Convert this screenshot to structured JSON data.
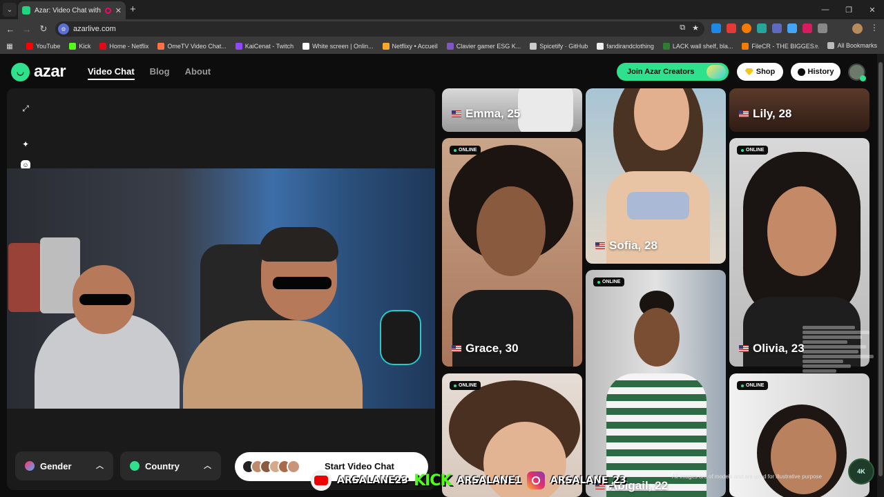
{
  "browser": {
    "tab_title": "Azar: Video Chat with New",
    "url": "azarlive.com",
    "bookmarks": [
      {
        "label": "YouTube",
        "color": "#ff0000"
      },
      {
        "label": "Kick",
        "color": "#53fc18"
      },
      {
        "label": "Home - Netflix",
        "color": "#e50914"
      },
      {
        "label": "OmeTV Video Chat...",
        "color": "#ff7043"
      },
      {
        "label": "KaiCenat - Twitch",
        "color": "#9146ff"
      },
      {
        "label": "White screen | Onlin...",
        "color": "#ffffff"
      },
      {
        "label": "Netflixy • Accueil",
        "color": "#f9a825"
      },
      {
        "label": "Clavier gamer ESG K...",
        "color": "#7e57c2"
      },
      {
        "label": "Spicetify · GitHub",
        "color": "#cccccc"
      },
      {
        "label": "fandirandclothing",
        "color": "#eeeeee"
      },
      {
        "label": "LACK wall shelf, bla...",
        "color": "#2e7d32"
      },
      {
        "label": "FileCR - THE BIGGES...",
        "color": "#f57c00"
      }
    ],
    "all_bookmarks": "All Bookmarks"
  },
  "site": {
    "logo": "azar",
    "nav": [
      "Video Chat",
      "Blog",
      "About"
    ],
    "creators_button": "Join Azar Creators",
    "shop_button": "Shop",
    "history_button": "History"
  },
  "controls": {
    "gender": "Gender",
    "country": "Country",
    "start": "Start Video Chat"
  },
  "gallery": {
    "online_label": "ONLINE",
    "profiles": [
      {
        "name": "Emma, 25",
        "online": false
      },
      {
        "name": "Sofia, 28",
        "online": false
      },
      {
        "name": "Lily, 28",
        "online": false
      },
      {
        "name": "Grace, 30",
        "online": true
      },
      {
        "name": "Olivia, 23",
        "online": true
      },
      {
        "name": "Abigail, 22",
        "online": true
      },
      {
        "name": "",
        "online": true
      },
      {
        "name": "",
        "online": true
      }
    ]
  },
  "overlay": {
    "youtube_handle": "ARSALANE23",
    "kick_label": "KICK",
    "kick_handle": "ARSALANE1",
    "instagram_handle": "ARSALANE_23",
    "disclaimer": "All images are of models and are used for illustrative purpose",
    "stream_logo": "4K"
  },
  "colors": {
    "accent": "#2fe08c",
    "background": "#0d0d0d"
  }
}
